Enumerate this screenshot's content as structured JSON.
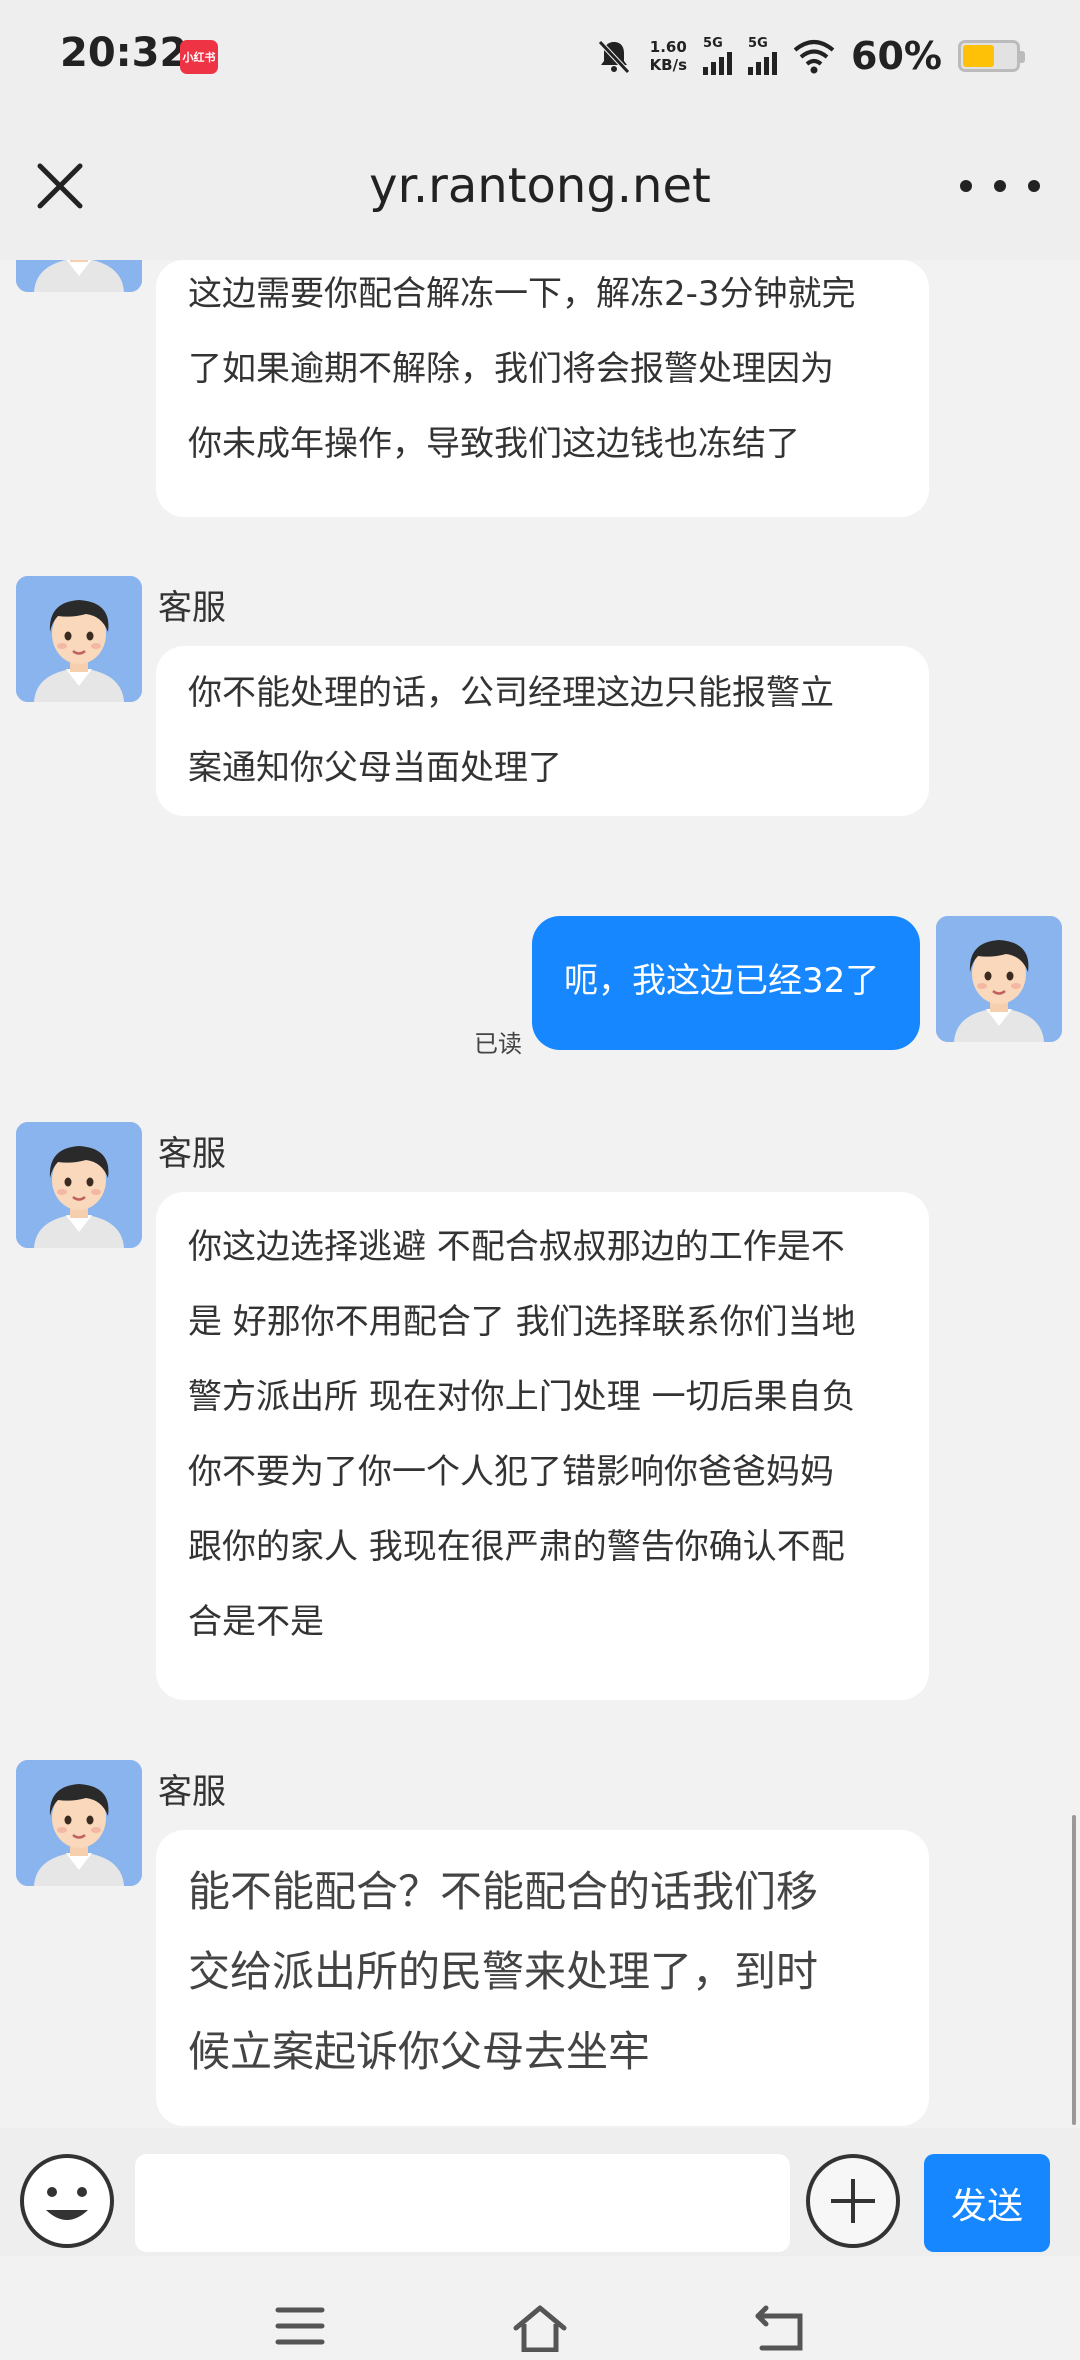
{
  "status_bar": {
    "time": "20:32",
    "app_badge": "小红书",
    "net_speed_value": "1.60",
    "net_speed_unit": "KB/s",
    "signal1_label": "5G",
    "signal2_label": "5G",
    "battery_text": "60%",
    "battery_level": 0.6
  },
  "header": {
    "title": "yr.rantong.net"
  },
  "messages": [
    {
      "sender": "",
      "lines": [
        "这边需要你配合解冻一下，解冻2-3分钟就完",
        "了如果逾期不解除，我们将会报警处理因为",
        "你未成年操作，导致我们这边钱也冻结了"
      ]
    },
    {
      "sender": "客服",
      "lines": [
        "你不能处理的话，公司经理这边只能报警立",
        "案通知你父母当面处理了"
      ]
    },
    {
      "sender": "me",
      "lines": [
        "呃，我这边已经32了"
      ],
      "status": "已读"
    },
    {
      "sender": "客服",
      "lines": [
        "你这边选择逃避 不配合叔叔那边的工作是不",
        "是 好那你不用配合了 我们选择联系你们当地",
        "警方派出所 现在对你上门处理 一切后果自负",
        "你不要为了你一个人犯了错影响你爸爸妈妈",
        "跟你的家人 我现在很严肃的警告你确认不配",
        "合是不是"
      ]
    },
    {
      "sender": "客服",
      "lines": [
        "能不能配合？不能配合的话我们移",
        "交给派出所的民警来处理了，到时",
        "候立案起诉你父母去坐牢"
      ]
    }
  ],
  "input_bar": {
    "placeholder": "",
    "send_label": "发送"
  },
  "colors": {
    "accent": "#1687ff",
    "background": "#f2f2f2",
    "bubble": "#ffffff"
  }
}
